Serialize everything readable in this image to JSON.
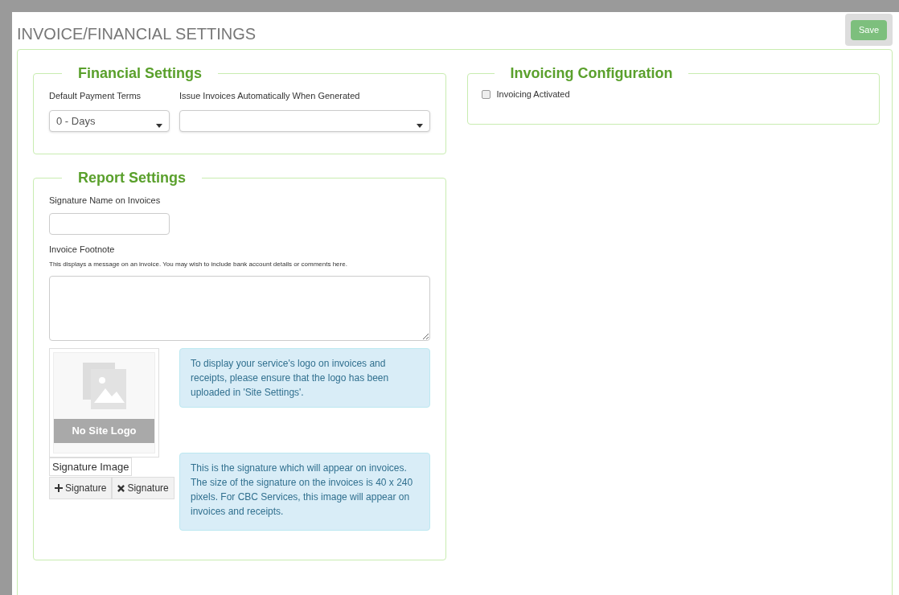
{
  "page": {
    "title": "INVOICE/FINANCIAL SETTINGS",
    "save_button": "Save"
  },
  "financial_settings": {
    "legend": "Financial Settings",
    "fields": [
      {
        "label": "Default Payment Terms",
        "value": "0 - Days"
      },
      {
        "label": "Issue Invoices Automatically When Generated"
      }
    ]
  },
  "invoicing_configuration": {
    "legend": "Invoicing Configuration",
    "checkbox": {
      "label": "Invoicing Activated",
      "checked": false
    }
  },
  "report_settings": {
    "legend": "Report Settings",
    "signature_name": {
      "label": "Signature Name on Invoices"
    },
    "footnote": {
      "label": "Invoice Footnote",
      "help": "This displays a message on an invoice. You may wish to include bank account details or comments here."
    },
    "logo": {
      "caption": "No Site Logo",
      "info": "To display your service's logo on invoices and receipts, please ensure that the logo has been uploaded in 'Site Settings'."
    },
    "signature": {
      "alt": "Signature Image",
      "buttons": [
        {
          "kind": "add",
          "label": "Signature"
        },
        {
          "kind": "remove",
          "label": "Signature"
        }
      ],
      "info": "This is the signature which will appear on invoices. The size of the signature on the invoices is 40 x 240 pixels. For CBC Services, this image will appear on invoices and receipts."
    }
  }
}
